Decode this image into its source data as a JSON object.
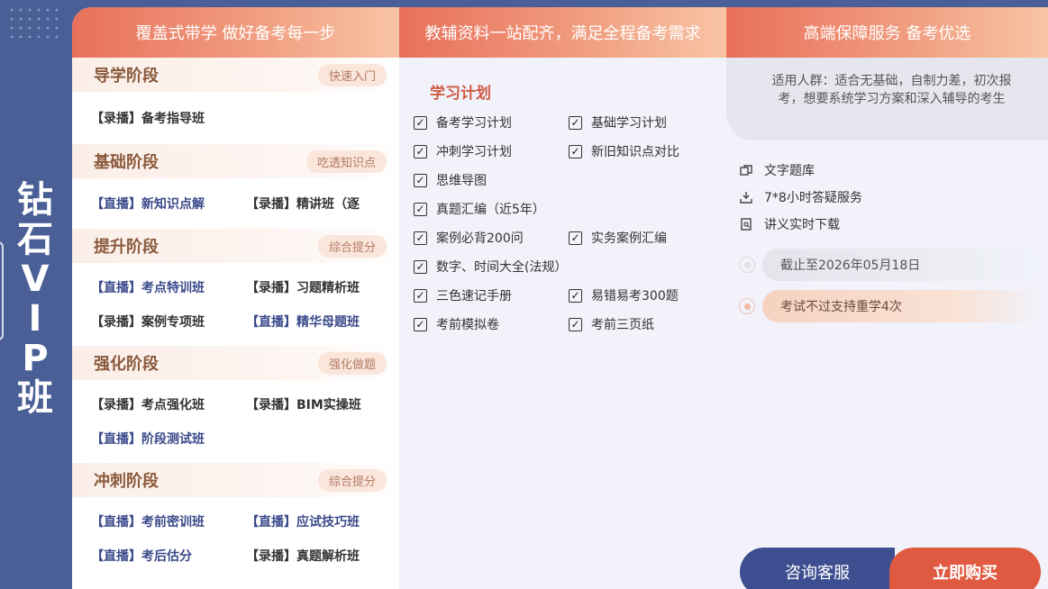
{
  "side_title": [
    "钻",
    "石",
    "V",
    "I",
    "P",
    "班"
  ],
  "headers": {
    "col1": "覆盖式带学 做好备考每一步",
    "col2": "教辅资料一站配齐，满足全程备考需求",
    "col3": "高端保障服务 备考优选"
  },
  "stages": [
    {
      "name": "导学阶段",
      "tag": "快速入门",
      "courses": [
        {
          "label": "【录播】备考指导班",
          "type": "recorded"
        }
      ]
    },
    {
      "name": "基础阶段",
      "tag": "吃透知识点",
      "courses": [
        {
          "label": "【直播】新知识点解",
          "type": "live"
        },
        {
          "label": "【录播】精讲班（逐",
          "type": "recorded"
        }
      ]
    },
    {
      "name": "提升阶段",
      "tag": "综合提分",
      "courses": [
        {
          "label": "【直播】考点特训班",
          "type": "live"
        },
        {
          "label": "【录播】习题精析班",
          "type": "recorded"
        },
        {
          "label": "【录播】案例专项班",
          "type": "recorded"
        },
        {
          "label": "【直播】精华母题班",
          "type": "live"
        }
      ]
    },
    {
      "name": "强化阶段",
      "tag": "强化做题",
      "courses": [
        {
          "label": "【录播】考点强化班",
          "type": "recorded"
        },
        {
          "label": "【录播】BIM实操班",
          "type": "recorded"
        },
        {
          "label": "【直播】阶段测试班",
          "type": "live"
        }
      ]
    },
    {
      "name": "冲刺阶段",
      "tag": "综合提分",
      "courses": [
        {
          "label": "【直播】考前密训班",
          "type": "live"
        },
        {
          "label": "【直播】应试技巧班",
          "type": "live"
        },
        {
          "label": "【直播】考后估分",
          "type": "live"
        },
        {
          "label": "【录播】真题解析班",
          "type": "recorded"
        }
      ]
    }
  ],
  "plan": {
    "title": "学习计划",
    "rows": [
      [
        "备考学习计划",
        "基础学习计划"
      ],
      [
        "冲刺学习计划",
        "新旧知识点对比"
      ],
      [
        "思维导图",
        ""
      ],
      [
        "真题汇编（近5年）",
        ""
      ],
      [
        "案例必背200问",
        "实务案例汇编"
      ],
      [
        "数字、时间大全(法规）",
        ""
      ],
      [
        "三色速记手册",
        "易错易考300题"
      ],
      [
        "考前模拟卷",
        "考前三页纸"
      ]
    ]
  },
  "service": {
    "audience": "适用人群：适合无基础，自制力差，初次报考，想要系统学习方案和深入辅导的考生",
    "items": [
      {
        "icon": "copy-icon",
        "label": "文字题库"
      },
      {
        "icon": "download-icon",
        "label": "7*8小时答疑服务"
      },
      {
        "icon": "document-icon",
        "label": "讲义实时下载"
      }
    ],
    "deadline": "截止至2026年05月18日",
    "guarantee": "考试不过支持重学4次"
  },
  "buttons": {
    "consult": "咨询客服",
    "buy": "立即购买"
  },
  "colors": {
    "sidebar": "#4a5f96",
    "header_gradient_start": "#e9705a",
    "live_course": "#3a4a8a",
    "consult_button": "#3e4f91",
    "buy_button": "#e05a42"
  }
}
